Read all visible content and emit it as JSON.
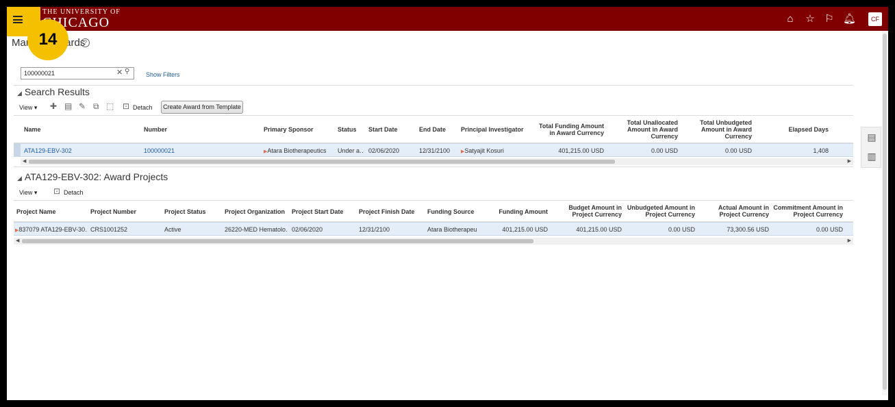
{
  "header": {
    "logo_line1": "THE UNIVERSITY OF",
    "logo_line2": "CHICAGO",
    "avatar_initials": "CF",
    "brand_color": "#800000",
    "step_badge": "14",
    "icons": [
      "home-icon",
      "star-icon",
      "flag-icon",
      "bell-icon"
    ]
  },
  "page": {
    "title": "Manage Awards"
  },
  "search": {
    "value": "100000021",
    "show_filters": "Show Filters"
  },
  "search_results": {
    "title": "Search Results",
    "view_label": "View",
    "detach_label": "Detach",
    "create_template_label": "Create Award from Template",
    "columns": [
      "Name",
      "Number",
      "Primary Sponsor",
      "Status",
      "Start Date",
      "End Date",
      "Principal Investigator",
      "Total Funding Amount in Award Currency",
      "Total Unallocated Amount in Award Currency",
      "Total Unbudgeted Amount in Award Currency",
      "Elapsed Days"
    ],
    "rows": [
      {
        "name": "ATA129-EBV-302",
        "number": "100000021",
        "sponsor": "Atara Biotherapeutics",
        "status": "Under a…",
        "start_date": "02/06/2020",
        "end_date": "12/31/2100",
        "pi": "Satyajit Kosuri",
        "total_funding": "401,215.00",
        "total_funding_cur": "USD",
        "total_unallocated": "0.00",
        "total_unallocated_cur": "USD",
        "total_unbudgeted": "0.00",
        "total_unbudgeted_cur": "USD",
        "elapsed_days": "1,408"
      }
    ]
  },
  "award_projects": {
    "title": "ATA129-EBV-302: Award Projects",
    "view_label": "View",
    "detach_label": "Detach",
    "columns": [
      "Project Name",
      "Project Number",
      "Project Status",
      "Project Organization",
      "Project Start Date",
      "Project Finish Date",
      "Funding Source",
      "Funding Amount",
      "Budget Amount in Project Currency",
      "Unbudgeted Amount in Project Currency",
      "Actual Amount in Project Currency",
      "Commitment Amount in Project Currency"
    ],
    "rows": [
      {
        "project_name": "837079 ATA129-EBV-30…",
        "project_number": "CRS1001252",
        "status": "Active",
        "organization": "26220-MED Hematolo…",
        "start_date": "02/06/2020",
        "finish_date": "12/31/2100",
        "funding_source": "Atara Biotherapeutic",
        "funding_amount": "401,215.00",
        "funding_cur": "USD",
        "budget_amount": "401,215.00",
        "budget_cur": "USD",
        "unbudgeted_amount": "0.00",
        "unbudgeted_cur": "USD",
        "actual_amount": "73,300.56",
        "actual_cur": "USD",
        "commitment_amount": "0.00",
        "commitment_cur": "USD"
      }
    ]
  }
}
